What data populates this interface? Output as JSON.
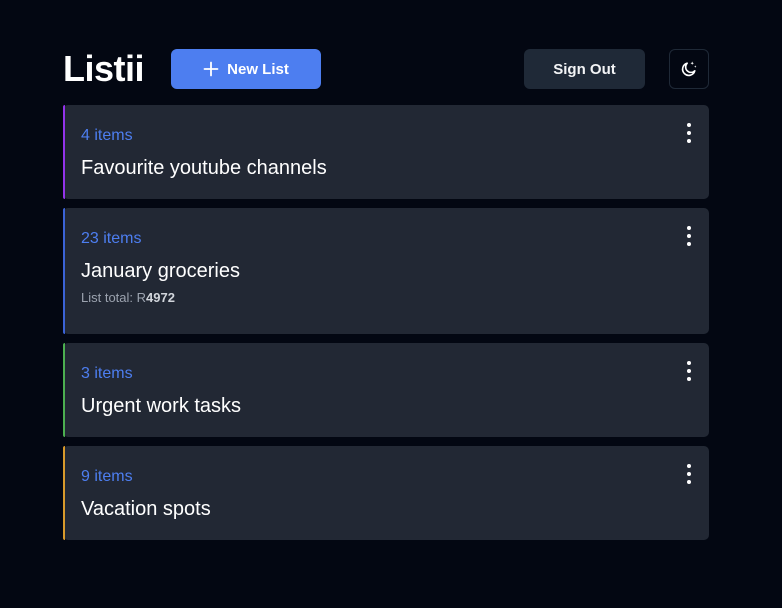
{
  "header": {
    "logo": "Listii",
    "new_list_label": "New List",
    "sign_out_label": "Sign Out",
    "theme_icon": "moon-stars-icon"
  },
  "colors": {
    "background": "#030712",
    "card": "#222834",
    "primary": "#4d7ef0",
    "secondary_button": "#1f2937"
  },
  "lists": [
    {
      "count": "4 items",
      "title": "Favourite youtube channels",
      "total_label": "",
      "total_value": "",
      "accent": "#9333ea"
    },
    {
      "count": "23 items",
      "title": "January groceries",
      "total_label": "List total: R",
      "total_value": "4972",
      "accent": "#3b63d6"
    },
    {
      "count": "3 items",
      "title": "Urgent work tasks",
      "total_label": "",
      "total_value": "",
      "accent": "#4caf50"
    },
    {
      "count": "9 items",
      "title": "Vacation spots",
      "total_label": "",
      "total_value": "",
      "accent": "#d89a2b"
    }
  ]
}
